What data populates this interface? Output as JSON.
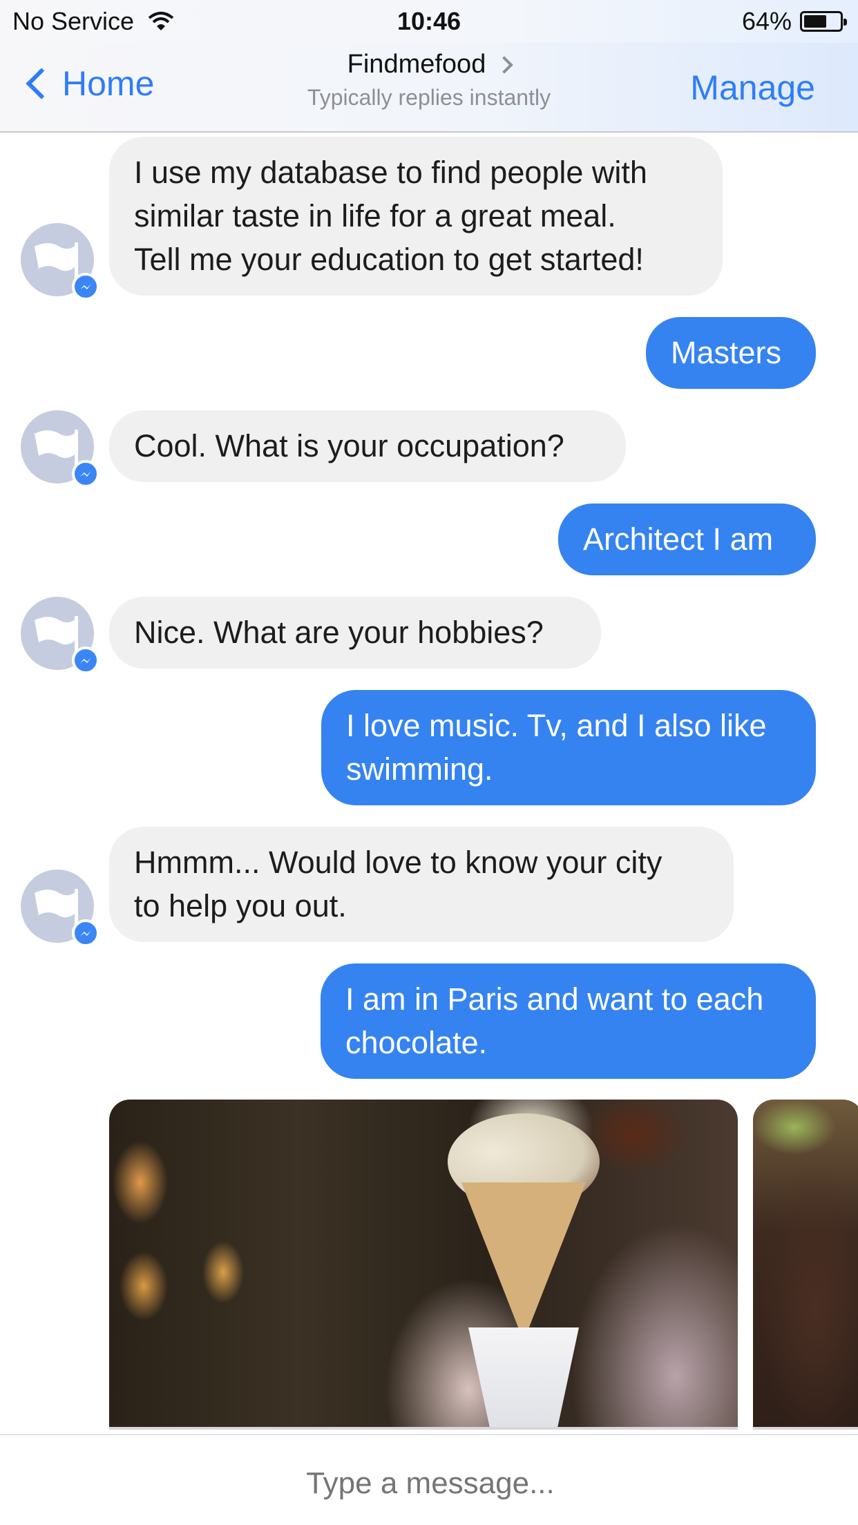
{
  "status_bar": {
    "carrier": "No Service",
    "time": "10:46",
    "battery": "64%",
    "battery_level": 0.64
  },
  "nav": {
    "back_label": "Home",
    "title": "Findmefood",
    "subtitle": "Typically replies instantly",
    "manage_label": "Manage"
  },
  "messages": [
    {
      "from": "bot",
      "lines": [
        "I use my database to find people with",
        "similar taste in life for a great meal.",
        "Tell me your education to get started!"
      ]
    },
    {
      "from": "user",
      "lines": [
        "Masters"
      ]
    },
    {
      "from": "bot",
      "lines": [
        "Cool. What is your occupation?"
      ]
    },
    {
      "from": "user",
      "lines": [
        "Architect I am"
      ]
    },
    {
      "from": "bot",
      "lines": [
        "Nice. What are your hobbies?"
      ]
    },
    {
      "from": "user",
      "lines": [
        "I love music. Tv, and I also like",
        "swimming."
      ]
    },
    {
      "from": "bot",
      "lines": [
        "Hmmm... Would love to know your city",
        "to help you out."
      ]
    },
    {
      "from": "user",
      "lines": [
        "I am in Paris and want to each",
        "chocolate."
      ]
    }
  ],
  "composer": {
    "placeholder": "Type a message..."
  },
  "colors": {
    "accent": "#2f7df6",
    "outgoing_bubble": "#3583f0",
    "incoming_bubble": "#f0f0f0"
  }
}
